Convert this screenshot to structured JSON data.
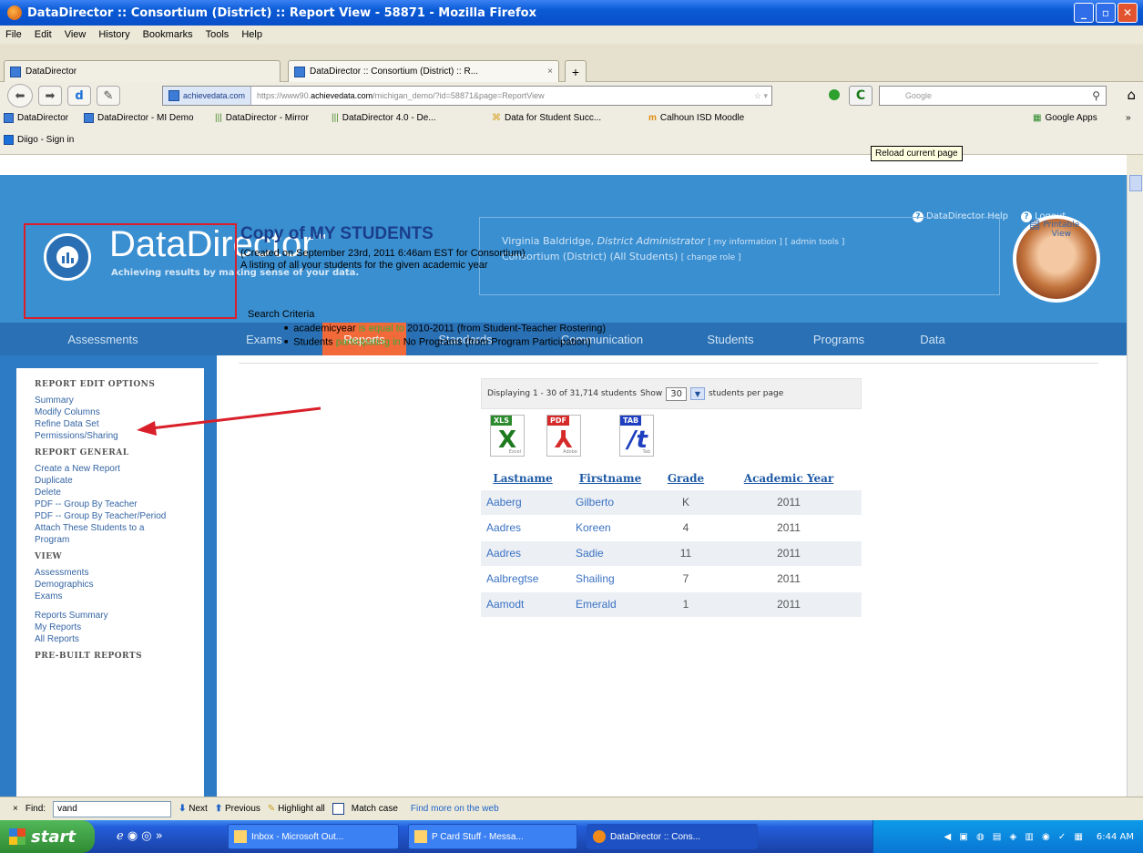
{
  "window": {
    "title": "DataDirector :: Consortium (District) :: Report View - 58871 - Mozilla Firefox"
  },
  "menu": [
    "File",
    "Edit",
    "View",
    "History",
    "Bookmarks",
    "Tools",
    "Help"
  ],
  "tabs": [
    {
      "label": "DataDirector"
    },
    {
      "label": "DataDirector :: Consortium (District) :: R...",
      "close": "×"
    }
  ],
  "newtab": "+",
  "address": {
    "identity": "achievedata.com",
    "prefix": "https://www90.",
    "host": "achievedata.com",
    "path": "/michigan_demo/?id=58871&page=ReportView"
  },
  "search": {
    "placeholder": "Google"
  },
  "bookmarks": [
    "DataDirector",
    "DataDirector - MI Demo",
    "DataDirector - Mirror",
    "DataDirector 4.0 - De...",
    "Data for Student Succ...",
    "Calhoun ISD Moodle",
    "Google Apps",
    "Diigo - Sign in"
  ],
  "bookmarks_overflow": "»",
  "tooltip": "Reload current page",
  "app": {
    "brand": "DataDirector",
    "tm": "™",
    "tagline": "Achieving results by making sense of your data.",
    "help_links": [
      "DataDirector Help",
      "Logout"
    ],
    "user_name": "Virginia Baldridge,",
    "user_role": "District Administrator",
    "user_links": "[ my information ] [ admin tools ]",
    "org": "Consortium (District) (All Students)",
    "org_link": "[ change role ]",
    "nav": [
      "Assessments",
      "Exams",
      "Reports",
      "Standards",
      "Communication",
      "Students",
      "Programs",
      "Data"
    ]
  },
  "sidebar": {
    "edit_head": "REPORT EDIT OPTIONS",
    "edit": [
      "Summary",
      "Modify Columns",
      "Refine Data Set",
      "Permissions/Sharing"
    ],
    "general_head": "REPORT GENERAL",
    "general": [
      "Create a New Report",
      "Duplicate",
      "Delete",
      "PDF -- Group By Teacher",
      "PDF -- Group By Teacher/Period",
      "Attach These Students to a Program"
    ],
    "view_head": "VIEW",
    "view1": [
      "Assessments",
      "Demographics",
      "Exams"
    ],
    "view2": [
      "Reports Summary",
      "My Reports",
      "All Reports"
    ],
    "prebuilt_head": "PRE-BUILT REPORTS"
  },
  "report": {
    "title": "Copy of MY STUDENTS",
    "created": "(Created on September 23rd, 2011 6:46am EST for Consortium)",
    "desc": "A listing of all your students for the given academic year",
    "printable": "Printable View",
    "criteria_label": "Search Criteria",
    "c1a": "academicyear ",
    "c1b": "is equal to",
    "c1c": " 2010-2011 (from Student-Teacher Rostering)",
    "c2a": "Students ",
    "c2b": "participating in",
    "c2c": " No Programs (from Program Participation)",
    "displaying": "Displaying 1 - 30 of 31,714 students",
    "show": "Show",
    "per_page_value": "30",
    "per_page": "students per page",
    "exports": [
      {
        "tag": "XLS",
        "label": "Excel",
        "glyph": "X"
      },
      {
        "tag": "PDF",
        "label": "Adobe",
        "glyph": "⅄"
      },
      {
        "tag": "TAB",
        "label": "Tab",
        "glyph": "/t"
      }
    ],
    "columns": [
      "Lastname",
      "Firstname",
      "Grade",
      "Academic Year"
    ],
    "rows": [
      [
        "Aaberg",
        "Gilberto",
        "K",
        "2011"
      ],
      [
        "Aadres",
        "Koreen",
        "4",
        "2011"
      ],
      [
        "Aadres",
        "Sadie",
        "11",
        "2011"
      ],
      [
        "Aalbregtse",
        "Shailing",
        "7",
        "2011"
      ],
      [
        "Aamodt",
        "Emerald",
        "1",
        "2011"
      ]
    ]
  },
  "findbar": {
    "close": "×",
    "label": "Find:",
    "value": "vand",
    "next": "Next",
    "previous": "Previous",
    "highlight": "Highlight all",
    "matchcase": "Match case",
    "more": "Find more on the web"
  },
  "taskbar": {
    "start": "start",
    "tasks": [
      "Inbox - Microsoft Out...",
      "P Card Stuff - Messa...",
      "DataDirector :: Cons..."
    ],
    "clock": "6:44 AM"
  }
}
